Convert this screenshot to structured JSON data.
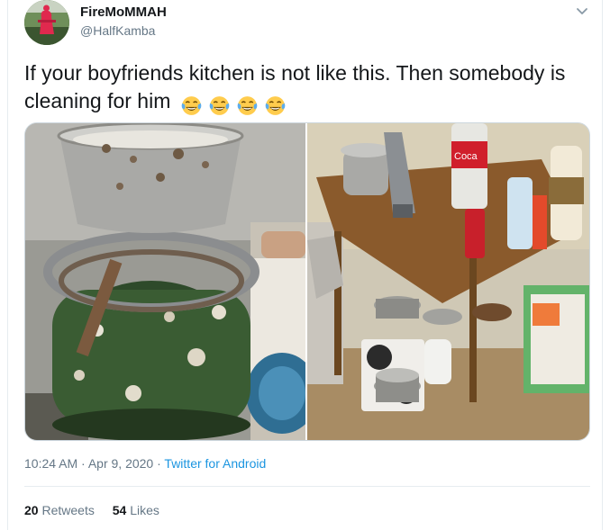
{
  "author": {
    "display_name": "FireMoMMAH",
    "handle": "@HalfKamba"
  },
  "tweet": {
    "text": "If your boyfriends kitchen is not like this.  Then somebody is cleaning for him",
    "emojis": [
      "face-with-tears-of-joy",
      "face-with-tears-of-joy",
      "face-with-tears-of-joy",
      "face-with-tears-of-joy"
    ],
    "media": [
      {
        "icon": "photo-dirty-gas-cylinder-stove"
      },
      {
        "icon": "photo-messy-kitchen-table"
      }
    ]
  },
  "meta": {
    "time": "10:24 AM",
    "separator": " · ",
    "date": "Apr 9, 2020",
    "source": "Twitter for Android"
  },
  "stats": {
    "retweets_count": "20",
    "retweets_label": "Retweets",
    "likes_count": "54",
    "likes_label": "Likes"
  },
  "colors": {
    "link": "#1b95e0",
    "secondary_text": "#657786",
    "border": "#e6ecf0"
  }
}
